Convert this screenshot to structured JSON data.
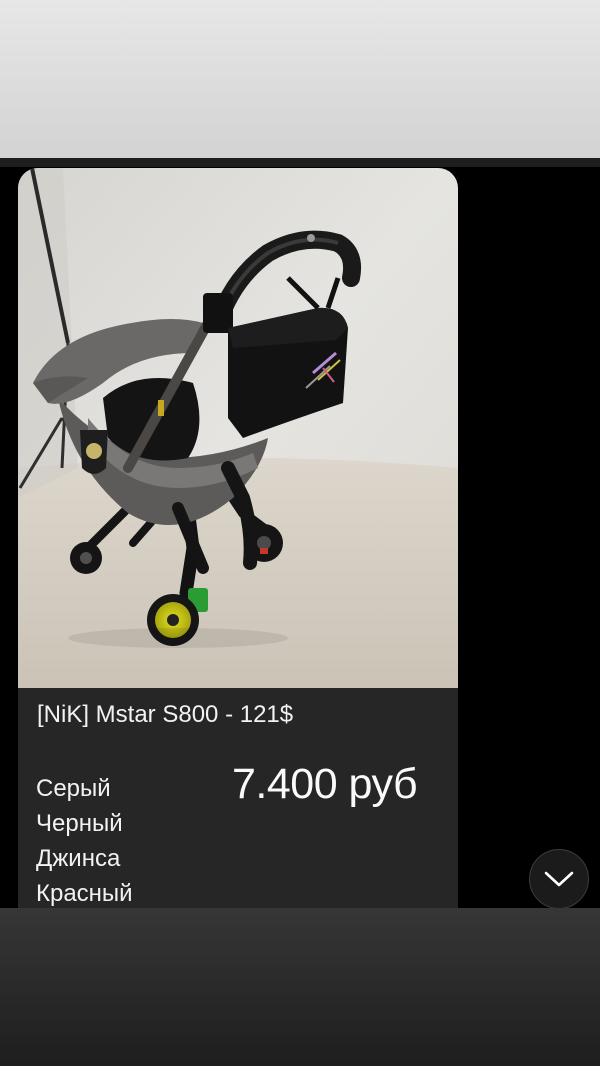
{
  "listing": {
    "title": "[NiK] Mstar S800 - 121$",
    "price": "7.400 руб",
    "colors": [
      "Серый",
      "Черный",
      "Джинса",
      "Красный"
    ]
  },
  "photo": {
    "subject": "stroller-car-seat-photo"
  },
  "controls": {
    "scroll_down_icon": "chevron-down-icon"
  },
  "theme": {
    "background": "#000000",
    "card_background": "#262626",
    "text_color": "#f2f2f2"
  }
}
